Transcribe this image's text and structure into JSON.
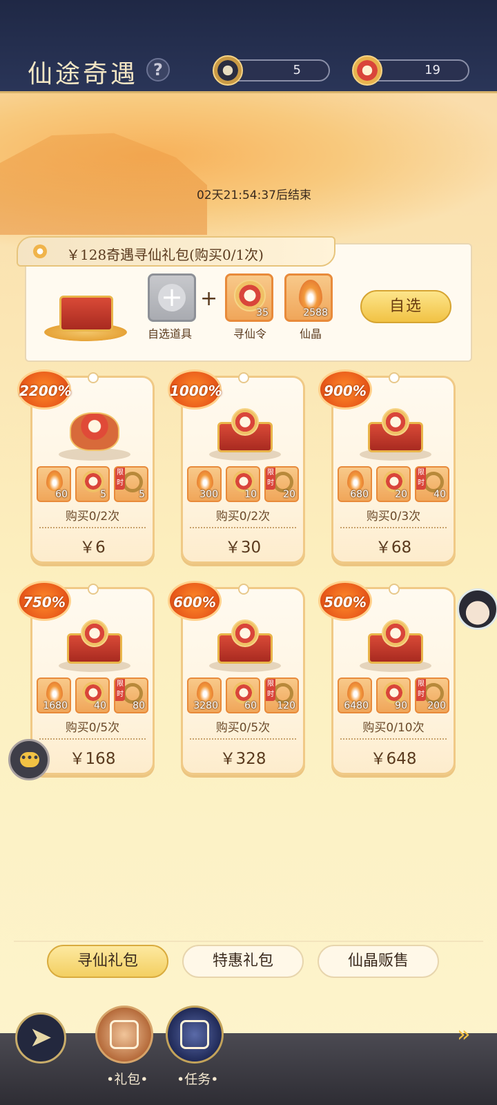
{
  "header": {
    "title": "仙途奇遇",
    "help_icon": "question-mark-icon",
    "currency_1": {
      "icon": "coin-dark-icon",
      "value": "5"
    },
    "currency_2": {
      "icon": "xun-xian-token-icon",
      "value": "19"
    }
  },
  "event": {
    "countdown": "02天21:54:37后结束"
  },
  "featured_pack": {
    "title": "￥128奇遇寻仙礼包(购买0/1次)",
    "items": [
      {
        "label": "自选道具",
        "count": ""
      },
      {
        "label": "寻仙令",
        "count": "35"
      },
      {
        "label": "仙晶",
        "count": "2588"
      }
    ],
    "plus": "+",
    "button_label": "自选"
  },
  "packs": [
    {
      "badge": "2200%",
      "items": [
        "60",
        "5",
        "5"
      ],
      "limit_tag": "限时",
      "buy_limit": "购买0/2次",
      "price": "￥6"
    },
    {
      "badge": "1000%",
      "items": [
        "300",
        "10",
        "20"
      ],
      "limit_tag": "限时",
      "buy_limit": "购买0/2次",
      "price": "￥30"
    },
    {
      "badge": "900%",
      "items": [
        "680",
        "20",
        "40"
      ],
      "limit_tag": "限时",
      "buy_limit": "购买0/3次",
      "price": "￥68"
    },
    {
      "badge": "750%",
      "items": [
        "1680",
        "40",
        "80"
      ],
      "limit_tag": "限时",
      "buy_limit": "购买0/5次",
      "price": "￥168"
    },
    {
      "badge": "600%",
      "items": [
        "3280",
        "60",
        "120"
      ],
      "limit_tag": "限时",
      "buy_limit": "购买0/5次",
      "price": "￥328"
    },
    {
      "badge": "500%",
      "items": [
        "6480",
        "90",
        "200"
      ],
      "limit_tag": "限时",
      "buy_limit": "购买0/10次",
      "price": "￥648"
    }
  ],
  "tabs": [
    {
      "label": "寻仙礼包",
      "active": true
    },
    {
      "label": "特惠礼包",
      "active": false
    },
    {
      "label": "仙晶贩售",
      "active": false
    }
  ],
  "nav": {
    "back_icon": "back-arrow-icon",
    "gift_label": "•礼包•",
    "task_label": "•任务•",
    "next_icon": "double-chevron-right-icon"
  },
  "floating": {
    "chat_icon": "chat-bubble-icon",
    "chat_glyph": "•••",
    "avatar": "npc-avatar"
  },
  "colors": {
    "accent_gold": "#f2c244",
    "badge_orange": "#e8591a",
    "header_navy": "#1f2845"
  }
}
